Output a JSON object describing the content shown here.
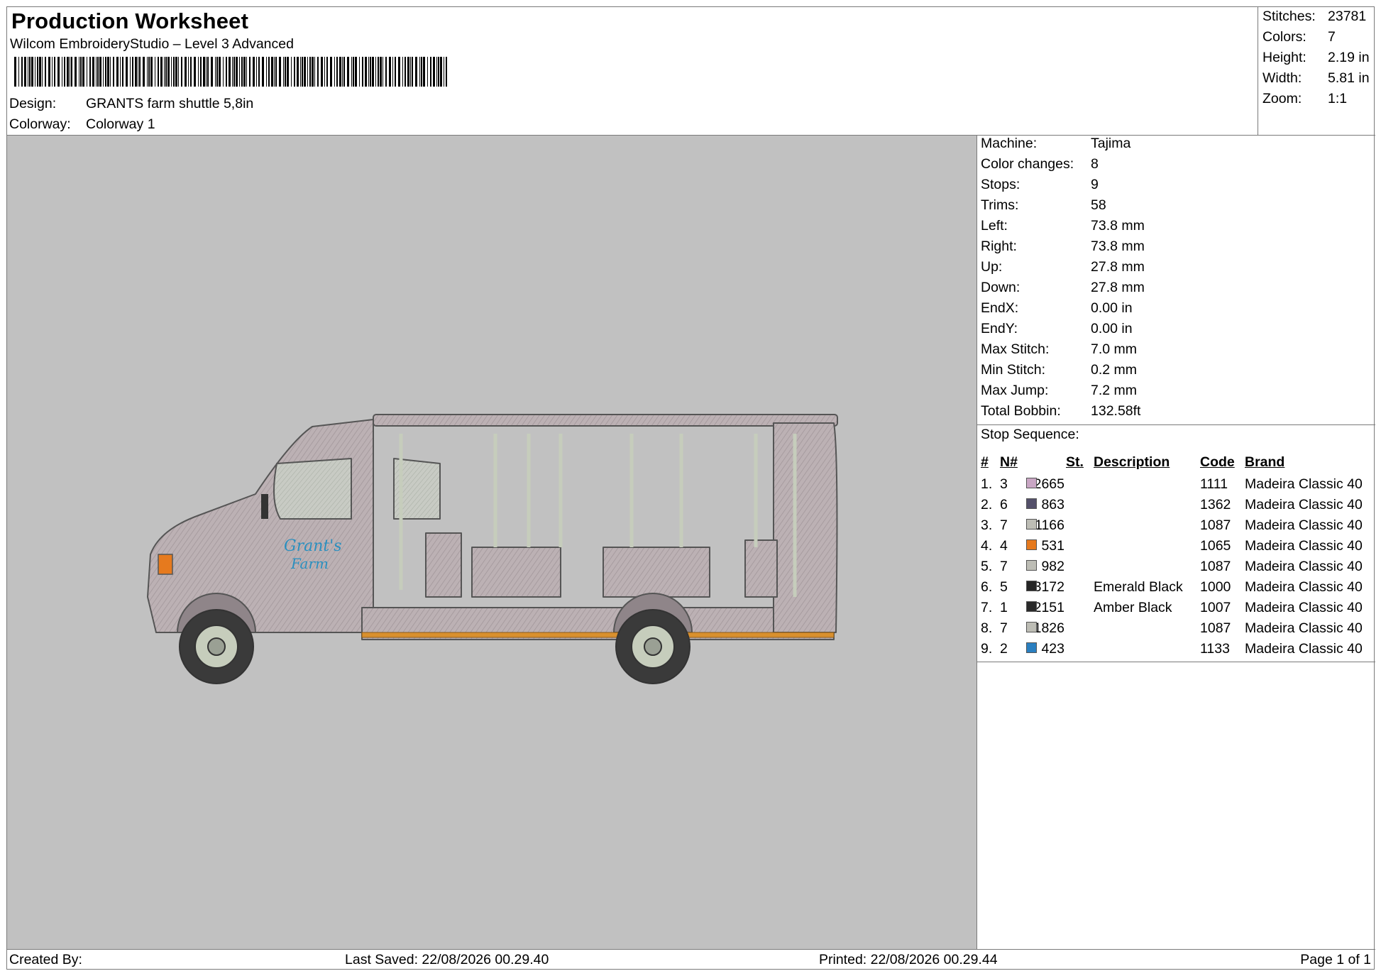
{
  "header": {
    "title": "Production Worksheet",
    "software": "Wilcom EmbroideryStudio – Level 3 Advanced",
    "design_label": "Design:",
    "design_value": "GRANTS farm shuttle 5,8in",
    "colorway_label": "Colorway:",
    "colorway_value": "Colorway 1"
  },
  "top_stats": [
    {
      "label": "Stitches:",
      "value": "23781"
    },
    {
      "label": "Colors:",
      "value": "7"
    },
    {
      "label": "Height:",
      "value": "2.19 in"
    },
    {
      "label": "Width:",
      "value": "5.81 in"
    },
    {
      "label": "Zoom:",
      "value": "1:1"
    }
  ],
  "machine_info": [
    {
      "label": "Machine:",
      "value": "Tajima"
    },
    {
      "label": "Color changes:",
      "value": "8"
    },
    {
      "label": "Stops:",
      "value": "9"
    },
    {
      "label": "Trims:",
      "value": "58"
    },
    {
      "label": "Left:",
      "value": "73.8 mm"
    },
    {
      "label": "Right:",
      "value": "73.8 mm"
    },
    {
      "label": "Up:",
      "value": "27.8 mm"
    },
    {
      "label": "Down:",
      "value": "27.8 mm"
    },
    {
      "label": "EndX:",
      "value": "0.00 in"
    },
    {
      "label": "EndY:",
      "value": "0.00 in"
    },
    {
      "label": "Max Stitch:",
      "value": "7.0 mm"
    },
    {
      "label": "Min Stitch:",
      "value": "0.2 mm"
    },
    {
      "label": "Max Jump:",
      "value": "7.2 mm"
    },
    {
      "label": "Total Bobbin:",
      "value": "132.58ft"
    }
  ],
  "stop_sequence": {
    "title": "Stop Sequence:",
    "columns": {
      "num": "#",
      "n": "N#",
      "st": "St.",
      "description": "Description",
      "code": "Code",
      "brand": "Brand"
    },
    "rows": [
      {
        "num": "1.",
        "n": "3",
        "color": "#c9a6c4",
        "st": "12665",
        "description": "",
        "code": "1111",
        "brand": "Madeira Classic 40"
      },
      {
        "num": "2.",
        "n": "6",
        "color": "#54506a",
        "st": "863",
        "description": "",
        "code": "1362",
        "brand": "Madeira Classic 40"
      },
      {
        "num": "3.",
        "n": "7",
        "color": "#bdbdb5",
        "st": "1166",
        "description": "",
        "code": "1087",
        "brand": "Madeira Classic 40"
      },
      {
        "num": "4.",
        "n": "4",
        "color": "#e67a1e",
        "st": "531",
        "description": "",
        "code": "1065",
        "brand": "Madeira Classic 40"
      },
      {
        "num": "5.",
        "n": "7",
        "color": "#bdbdb5",
        "st": "982",
        "description": "",
        "code": "1087",
        "brand": "Madeira Classic 40"
      },
      {
        "num": "6.",
        "n": "5",
        "color": "#252525",
        "st": "3172",
        "description": "Emerald Black",
        "code": "1000",
        "brand": "Madeira Classic 40"
      },
      {
        "num": "7.",
        "n": "1",
        "color": "#2a2a2a",
        "st": "2151",
        "description": "Amber Black",
        "code": "1007",
        "brand": "Madeira Classic 40"
      },
      {
        "num": "8.",
        "n": "7",
        "color": "#bdbdb5",
        "st": "1826",
        "description": "",
        "code": "1087",
        "brand": "Madeira Classic 40"
      },
      {
        "num": "9.",
        "n": "2",
        "color": "#2a7fc0",
        "st": "423",
        "description": "",
        "code": "1133",
        "brand": "Madeira Classic 40"
      }
    ]
  },
  "design_preview": {
    "logo_text_1": "Grant's",
    "logo_text_2": "Farm",
    "body_color": "#b9aeb1",
    "stripe_color": "#d9902e",
    "rail_color": "#c6cdbc",
    "logo_color": "#2a8fbf"
  },
  "footer": {
    "created_by": "Created By:",
    "last_saved": "Last Saved: 22/08/2026 00.29.40",
    "printed": "Printed: 22/08/2026 00.29.44",
    "page": "Page 1 of 1"
  }
}
